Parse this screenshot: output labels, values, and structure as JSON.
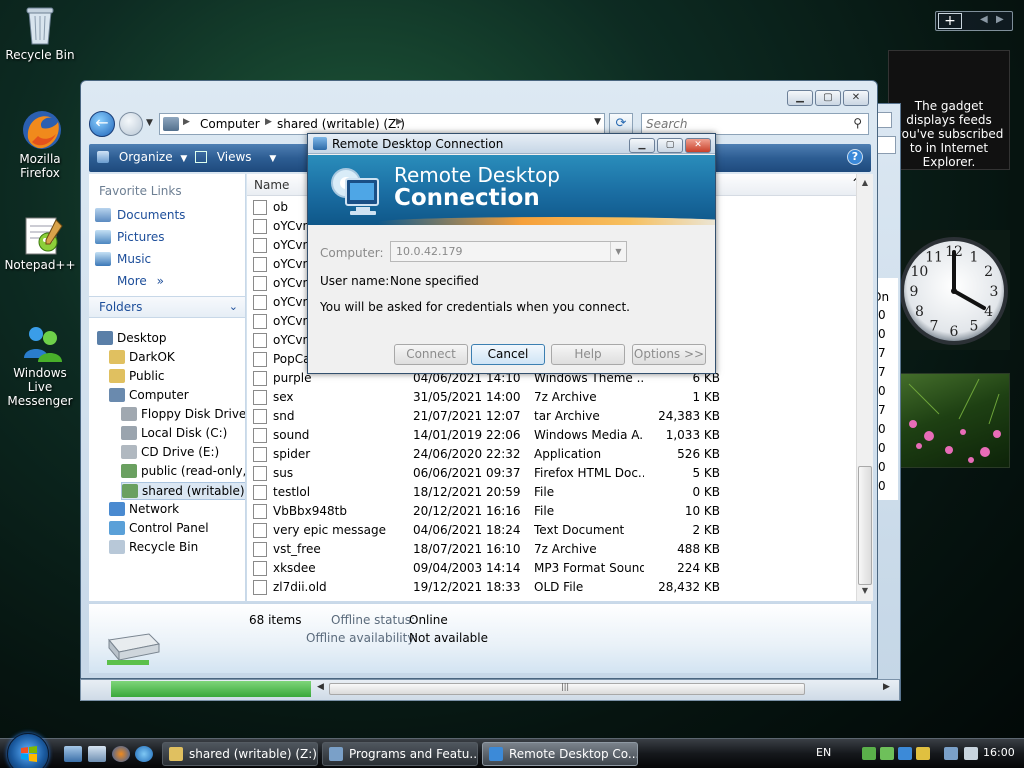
{
  "desktop": {
    "icons": [
      {
        "label": "Recycle Bin"
      },
      {
        "label": "Mozilla Firefox"
      },
      {
        "label": "Notepad++"
      },
      {
        "label": "Windows Live Messenger"
      }
    ]
  },
  "sidebar": {
    "add_gadget": "+",
    "feed_gadget_text": "The gadget displays feeds you've subscribed to in Internet Explorer.",
    "clock_numbers": [
      "12",
      "1",
      "2",
      "3",
      "4",
      "5",
      "6",
      "7",
      "8",
      "9",
      "10",
      "11"
    ]
  },
  "explorer": {
    "breadcrumb": [
      "Computer",
      "shared (writable) (Z:)"
    ],
    "search_placeholder": "Search",
    "toolbar": {
      "organize": "Organize",
      "views": "Views",
      "help": "?"
    },
    "favorite_links_title": "Favorite Links",
    "favorite_links": [
      "Documents",
      "Pictures",
      "Music"
    ],
    "more_label": "More",
    "folders_title": "Folders",
    "tree": [
      {
        "label": "Desktop",
        "level": 0
      },
      {
        "label": "DarkOK",
        "level": 1
      },
      {
        "label": "Public",
        "level": 1
      },
      {
        "label": "Computer",
        "level": 1
      },
      {
        "label": "Floppy Disk Drive (A",
        "level": 2
      },
      {
        "label": "Local Disk (C:)",
        "level": 2
      },
      {
        "label": "CD Drive (E:)",
        "level": 2
      },
      {
        "label": "public (read-only, n",
        "level": 2
      },
      {
        "label": "shared (writable) (Z:",
        "level": 2,
        "selected": true
      },
      {
        "label": "Network",
        "level": 1
      },
      {
        "label": "Control Panel",
        "level": 1
      },
      {
        "label": "Recycle Bin",
        "level": 1
      }
    ],
    "column_name": "Name",
    "files": [
      {
        "name": "ob",
        "date": "",
        "type": "",
        "size": ""
      },
      {
        "name": "oYCvn",
        "date": "",
        "type": "",
        "size": ""
      },
      {
        "name": "oYCvn",
        "date": "",
        "type": "",
        "size": ""
      },
      {
        "name": "oYCvn",
        "date": "",
        "type": "",
        "size": ""
      },
      {
        "name": "oYCvn",
        "date": "",
        "type": "",
        "size": ""
      },
      {
        "name": "oYCvn",
        "date": "",
        "type": "",
        "size": ""
      },
      {
        "name": "oYCvn",
        "date": "",
        "type": "",
        "size": ""
      },
      {
        "name": "oYCvn",
        "date": "",
        "type": "",
        "size": ""
      },
      {
        "name": "PopCa",
        "date": "",
        "type": "",
        "size": ""
      },
      {
        "name": "purple",
        "date": "04/06/2021 14:10",
        "type": "Windows Theme ...",
        "size": "6 KB"
      },
      {
        "name": "sex",
        "date": "31/05/2021 14:00",
        "type": "7z Archive",
        "size": "1 KB"
      },
      {
        "name": "snd",
        "date": "21/07/2021 12:07",
        "type": "tar Archive",
        "size": "24,383 KB"
      },
      {
        "name": "sound",
        "date": "14/01/2019 22:06",
        "type": "Windows Media A...",
        "size": "1,033 KB"
      },
      {
        "name": "spider",
        "date": "24/06/2020 22:32",
        "type": "Application",
        "size": "526 KB"
      },
      {
        "name": "sus",
        "date": "06/06/2021 09:37",
        "type": "Firefox HTML Doc...",
        "size": "5 KB"
      },
      {
        "name": "testlol",
        "date": "18/12/2021 20:59",
        "type": "File",
        "size": "0 KB"
      },
      {
        "name": "VbBbx948tb",
        "date": "20/12/2021 16:16",
        "type": "File",
        "size": "10 KB"
      },
      {
        "name": "very epic message",
        "date": "04/06/2021 18:24",
        "type": "Text Document",
        "size": "2 KB"
      },
      {
        "name": "vst_free",
        "date": "18/07/2021 16:10",
        "type": "7z Archive",
        "size": "488 KB"
      },
      {
        "name": "xksdee",
        "date": "09/04/2003 14:14",
        "type": "MP3 Format Sound",
        "size": "224 KB"
      },
      {
        "name": "zl7dii.old",
        "date": "19/12/2021 18:33",
        "type": "OLD File",
        "size": "28,432 KB"
      }
    ],
    "details": {
      "item_count": "68 items",
      "offline_status_label": "Offline status:",
      "offline_status_value": "Online",
      "offline_avail_label": "Offline availability:",
      "offline_avail_value": "Not available"
    }
  },
  "background_window": {
    "column_fragment": "On",
    "values": [
      "0",
      "0",
      "7",
      "7",
      "0",
      "7",
      "0",
      "0",
      "0",
      "0"
    ]
  },
  "rdc": {
    "title": "Remote Desktop Connection",
    "banner_line1": "Remote Desktop",
    "banner_line2": "Connection",
    "computer_label": "Computer:",
    "computer_value": "10.0.42.179",
    "username_label": "User name:",
    "username_value": "None specified",
    "info": "You will be asked for credentials when you connect.",
    "buttons": {
      "connect": "Connect",
      "cancel": "Cancel",
      "help": "Help",
      "options": "Options >>"
    }
  },
  "taskbar": {
    "buttons": [
      {
        "label": "shared (writable) (Z:)",
        "active": false
      },
      {
        "label": "Programs and Featu...",
        "active": false
      },
      {
        "label": "Remote Desktop Co...",
        "active": true
      }
    ],
    "language": "EN",
    "clock": "16:00"
  }
}
